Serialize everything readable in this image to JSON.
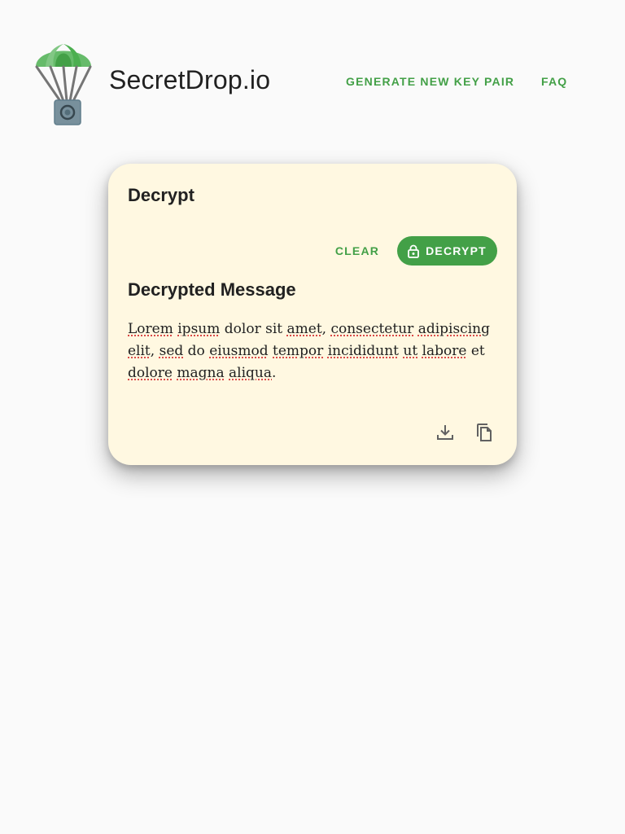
{
  "header": {
    "brand": "SecretDrop.io",
    "nav": {
      "generate_label": "GENERATE NEW KEY PAIR",
      "faq_label": "FAQ"
    }
  },
  "card": {
    "title": "Decrypt",
    "actions": {
      "clear_label": "CLEAR",
      "decrypt_label": "DECRYPT",
      "decrypt_icon": "lock-icon"
    },
    "section_title": "Decrypted Message",
    "message_parts": [
      "Lorem",
      " ",
      "ipsum",
      " dolor sit ",
      "amet",
      ", ",
      "consectetur",
      " ",
      "adipiscing",
      " ",
      "elit",
      ", ",
      "sed",
      " do ",
      "eiusmod",
      " ",
      "tempor",
      " ",
      "incididunt",
      " ",
      "ut",
      " ",
      "labore",
      " et ",
      "dolore",
      " ",
      "magna",
      " ",
      "aliqua",
      "."
    ],
    "footer_icons": [
      "download-icon",
      "copy-icon"
    ]
  },
  "colors": {
    "accent": "#43a047",
    "card_bg": "#fff8e1",
    "page_bg": "#fafafa",
    "spell_underline": "#d32f2f"
  }
}
